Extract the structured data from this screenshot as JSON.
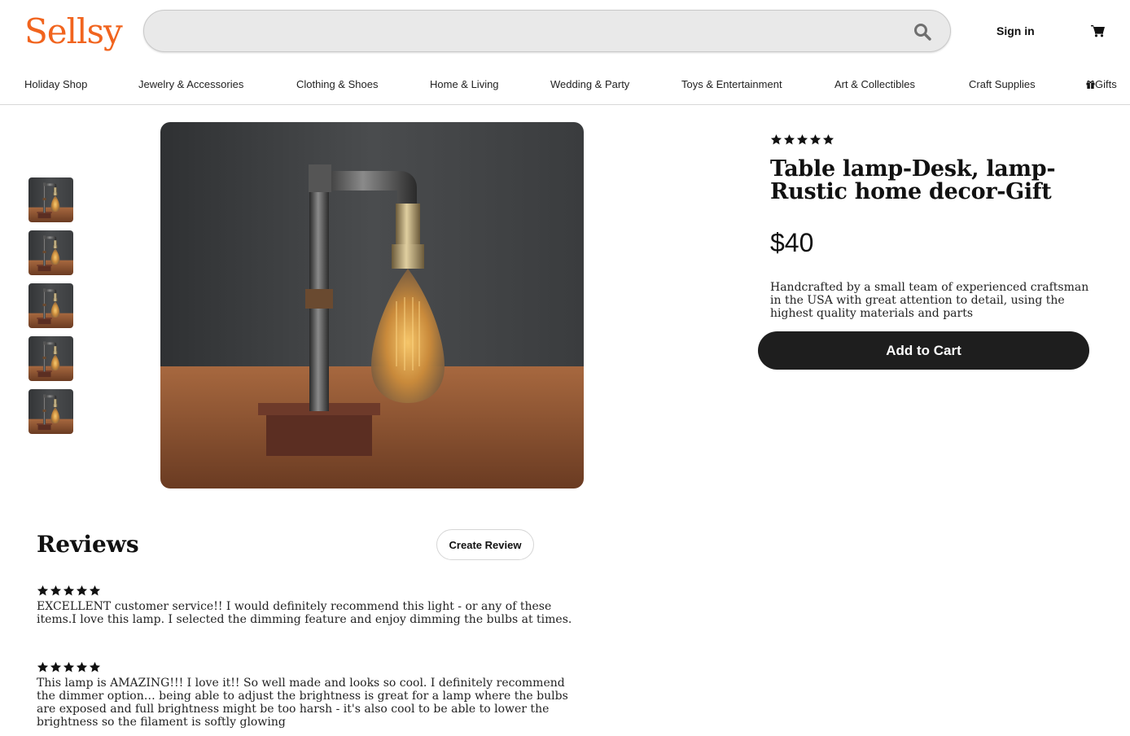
{
  "header": {
    "logo": "Sellsy",
    "search_placeholder": "",
    "sign_in": "Sign in"
  },
  "nav": {
    "items": [
      "Holiday Shop",
      "Jewelry & Accessories",
      "Clothing & Shoes",
      "Home & Living",
      "Wedding & Party",
      "Toys & Entertainment",
      "Art & Collectibles",
      "Craft Supplies",
      "Gifts"
    ]
  },
  "product": {
    "rating": 5,
    "title": "Table lamp-Desk, lamp-Rustic home decor-Gift",
    "price": "$40",
    "description": "Handcrafted by a small team of experienced craftsman in the USA with great attention to detail, using the highest quality materials and parts",
    "add_to_cart": "Add to Cart"
  },
  "reviews": {
    "title": "Reviews",
    "create_label": "Create Review",
    "items": [
      {
        "rating": 5,
        "text": "EXCELLENT customer service!! I would definitely recommend this light - or any of these items.I love this lamp. I selected the dimming feature and enjoy dimming the bulbs at times."
      },
      {
        "rating": 5,
        "text": "This lamp is AMAZING!!! I love it!! So well made and looks so cool. I definitely recommend the dimmer option… being able to adjust the brightness is great for a lamp where the bulbs are exposed and full brightness might be too harsh - it's also cool to be able to lower the brightness so the filament is softly glowing"
      }
    ]
  },
  "colors": {
    "brand": "#f1641e",
    "button_dark": "#1e1e1e"
  }
}
